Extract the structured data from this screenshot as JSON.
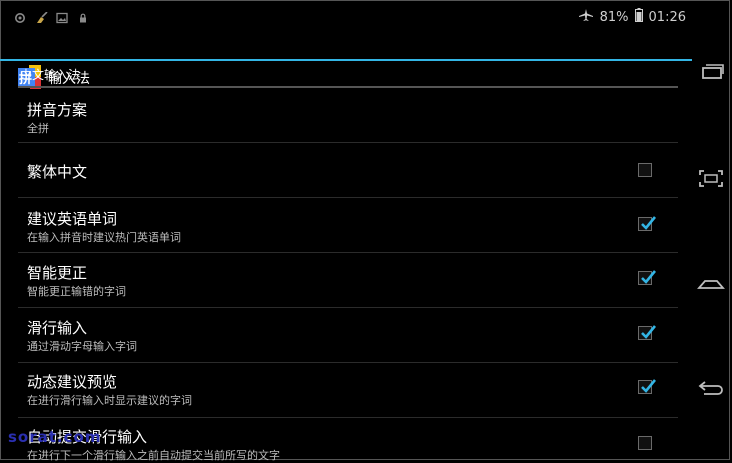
{
  "status": {
    "battery_percent": "81%",
    "time": "01:26"
  },
  "app": {
    "icon_text": "拼",
    "title": "输入法"
  },
  "section": {
    "header": "中文输入法"
  },
  "settings": [
    {
      "title": "拼音方案",
      "subtitle": "全拼"
    },
    {
      "title": "繁体中文",
      "checked": false
    },
    {
      "title": "建议英语单词",
      "subtitle": "在输入拼音时建议热门英语单词",
      "checked": true
    },
    {
      "title": "智能更正",
      "subtitle": "智能更正输错的字词",
      "checked": true
    },
    {
      "title": "滑行输入",
      "subtitle": "通过滑动字母输入字词",
      "checked": true
    },
    {
      "title": "动态建议预览",
      "subtitle": "在进行滑行输入时显示建议的字词",
      "checked": true
    },
    {
      "title": "自动提交滑行输入",
      "subtitle": "在进行下一个滑行输入之前自动提交当前所写的文字",
      "checked": false
    }
  ],
  "colors": {
    "accent": "#33b5e5",
    "background": "#000000"
  },
  "watermark": "sorat.com"
}
